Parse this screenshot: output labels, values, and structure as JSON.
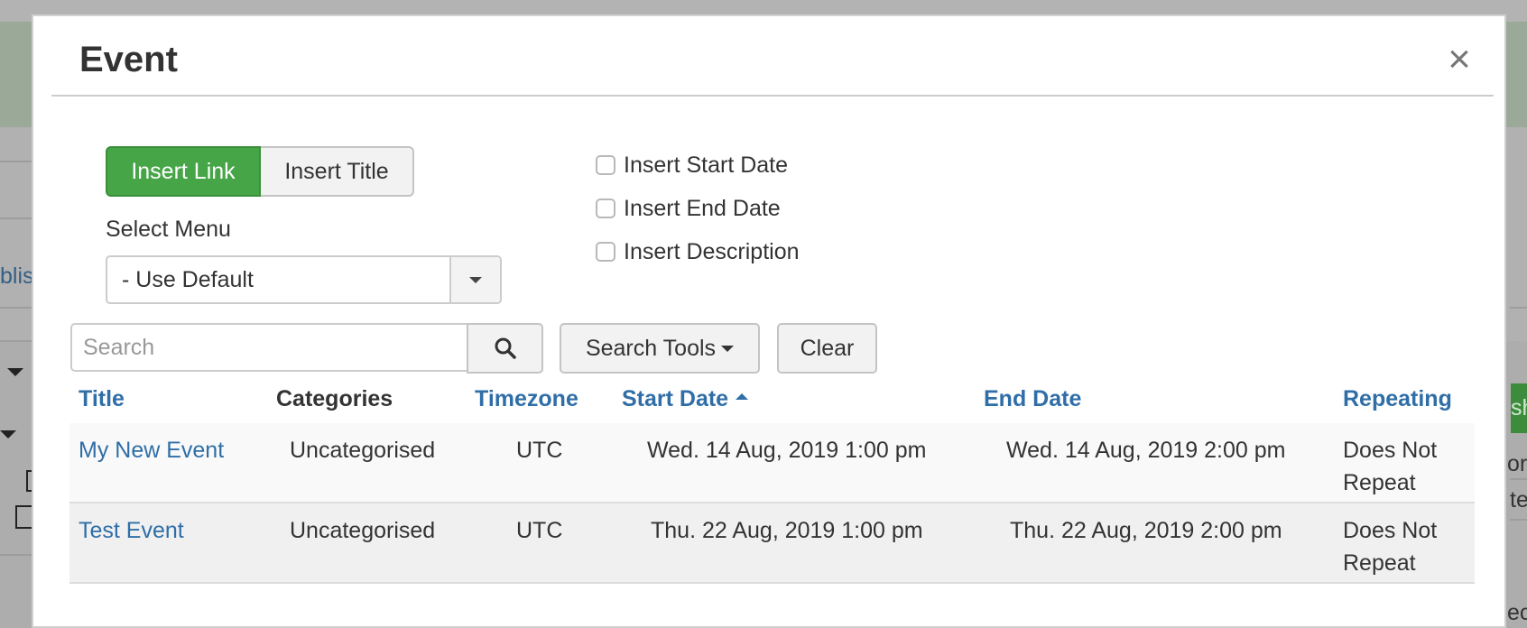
{
  "background": {
    "left_link_fragment": "blis",
    "right_button_fragment": "sh",
    "right_text_fragments": [
      "ory",
      "te",
      "ec"
    ],
    "accent_green": "#46a546",
    "link_blue": "#2f6ea7"
  },
  "modal": {
    "title": "Event",
    "close_label": "×",
    "insert_mode": {
      "options": [
        "Insert Link",
        "Insert Title"
      ],
      "active": "Insert Link"
    },
    "select_menu": {
      "label": "Select Menu",
      "value": "- Use Default"
    },
    "checkboxes": [
      {
        "label": "Insert Start Date",
        "checked": false
      },
      {
        "label": "Insert End Date",
        "checked": false
      },
      {
        "label": "Insert Description",
        "checked": false
      }
    ],
    "search": {
      "placeholder": "Search",
      "value": "",
      "search_icon": "search-icon",
      "tools_label": "Search Tools",
      "clear_label": "Clear"
    },
    "table": {
      "columns": [
        {
          "label": "Title",
          "sortable": true
        },
        {
          "label": "Categories",
          "sortable": false
        },
        {
          "label": "Timezone",
          "sortable": true
        },
        {
          "label": "Start Date",
          "sortable": true,
          "sorted": "asc"
        },
        {
          "label": "End Date",
          "sortable": true
        },
        {
          "label": "Repeating",
          "sortable": true
        }
      ],
      "rows": [
        {
          "title": "My New Event",
          "category": "Uncategorised",
          "timezone": "UTC",
          "start": "Wed. 14 Aug, 2019 1:00 pm",
          "end": "Wed. 14 Aug, 2019 2:00 pm",
          "repeating": "Does Not Repeat"
        },
        {
          "title": "Test Event",
          "category": "Uncategorised",
          "timezone": "UTC",
          "start": "Thu. 22 Aug, 2019 1:00 pm",
          "end": "Thu. 22 Aug, 2019 2:00 pm",
          "repeating": "Does Not Repeat"
        }
      ]
    }
  }
}
